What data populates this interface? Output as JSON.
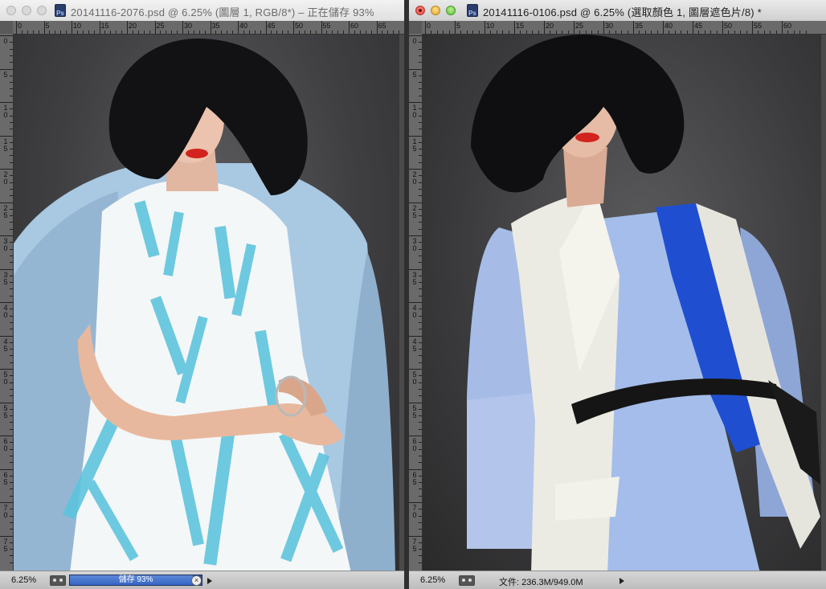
{
  "left_window": {
    "title": "20141116-2076.psd @ 6.25% (圖層 1, RGB/8*) – 正在儲存 93%",
    "ruler_top": [
      "0",
      "5",
      "10",
      "15",
      "20",
      "25",
      "30",
      "35",
      "40",
      "45",
      "50",
      "55",
      "60",
      "65"
    ],
    "ruler_left": [
      "0",
      "5",
      "10",
      "15",
      "20",
      "25",
      "30",
      "35",
      "40",
      "45",
      "50",
      "55",
      "60",
      "65",
      "70",
      "75"
    ],
    "status": {
      "zoom": "6.25%",
      "progress_label": "儲存 93%",
      "progress": 0.93
    }
  },
  "right_window": {
    "title": "20141116-0106.psd @ 6.25% (選取顏色 1, 圖層遮色片/8) *",
    "ruler_top": [
      "0",
      "5",
      "10",
      "15",
      "20",
      "25",
      "30",
      "35",
      "40",
      "45",
      "50",
      "55",
      "60"
    ],
    "ruler_left": [
      "0",
      "5",
      "10",
      "15",
      "20",
      "25",
      "30",
      "35",
      "40",
      "45",
      "50",
      "55",
      "60",
      "65",
      "70",
      "75"
    ],
    "status": {
      "zoom": "6.25%",
      "doc_info": "文件: 236.3M/949.0M"
    }
  },
  "colors": {
    "progress": "#3566c4",
    "coat_light_blue": "#a9c8e2",
    "dress_stripe": "#5ec3dc",
    "blazer_white": "#ecebe3",
    "panel_blue": "#1f4fd0",
    "belt": "#151515",
    "lips": "#d2231e"
  },
  "icons": [
    "photoshop-document-icon",
    "status-toggle-icon",
    "cancel-icon",
    "status-menu-arrow-icon"
  ]
}
